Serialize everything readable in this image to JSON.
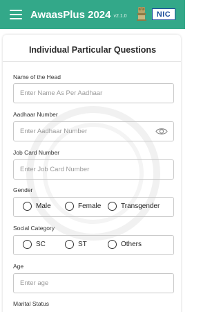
{
  "appbar": {
    "title": "AwaasPlus 2024",
    "version": "v2.1.0",
    "nic_logo": "NIC"
  },
  "card": {
    "title": "Individual Particular Questions"
  },
  "fields": {
    "head_name": {
      "label": "Name of the Head",
      "placeholder": "Enter Name As Per Aadhaar"
    },
    "aadhaar": {
      "label": "Aadhaar Number",
      "placeholder": "Enter Aadhaar Number",
      "icon": "eye-icon"
    },
    "job_card": {
      "label": "Job Card Number",
      "placeholder": "Enter Job Card Number"
    },
    "age": {
      "label": "Age",
      "placeholder": "Enter age"
    }
  },
  "gender": {
    "label": "Gender",
    "options": [
      "Male",
      "Female",
      "Transgender"
    ]
  },
  "social_category": {
    "label": "Social Category",
    "options": [
      "SC",
      "ST",
      "Others"
    ]
  },
  "marital_status": {
    "label": "Marital Status"
  },
  "colors": {
    "appbar": "#33a889",
    "nic_blue": "#1d4f9c"
  }
}
